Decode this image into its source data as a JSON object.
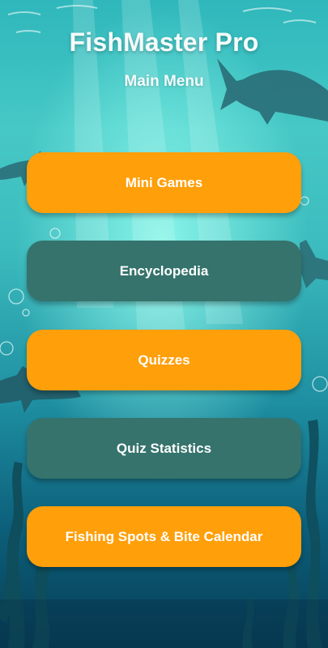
{
  "app": {
    "title": "FishMaster Pro",
    "subtitle": "Main Menu"
  },
  "menu": {
    "items": [
      {
        "label": "Mini Games",
        "color": "#ff9f0a"
      },
      {
        "label": "Encyclopedia",
        "color": "#35736c"
      },
      {
        "label": "Quizzes",
        "color": "#ff9f0a"
      },
      {
        "label": "Quiz Statistics",
        "color": "#35736c"
      },
      {
        "label": "Fishing Spots & Bite Calendar",
        "color": "#ff9f0a"
      }
    ]
  },
  "background": {
    "scene": "underwater-with-sharks-and-seaweed",
    "accent_orange": "#ff9f0a",
    "accent_teal": "#35736c"
  }
}
